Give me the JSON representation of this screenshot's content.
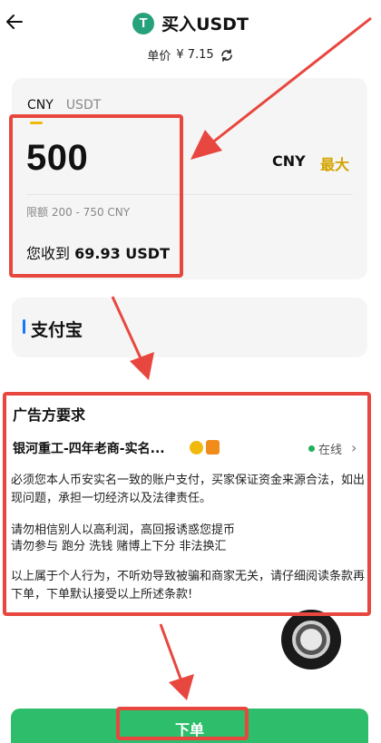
{
  "header": {
    "back_icon": "arrow-left-icon",
    "logo_icon": "tether-icon",
    "logo_letter": "T",
    "title": "买入USDT",
    "price_label": "单价",
    "price_value": "¥ 7.15",
    "refresh_icon": "refresh-icon"
  },
  "amount_card": {
    "tabs": [
      {
        "label": "CNY",
        "active": true
      },
      {
        "label": "USDT",
        "active": false
      }
    ],
    "amount": "500",
    "unit": "CNY",
    "max_label": "最大",
    "limit": "限额 200 - 750 CNY",
    "receive_label": "您收到",
    "receive_value": "69.93 USDT"
  },
  "payment": {
    "method": "支付宝"
  },
  "advertiser": {
    "section_title": "广告方要求",
    "merchant_name": "银河重工-四年老商-实名...",
    "status": "在线",
    "paragraphs": [
      "必须您本人币安实名一致的账户支付，买家保证资金来源合法，如出现问题，承担一切经济以及法律责任。",
      "请勿相信别人以高利润，高回报诱惑您提币",
      "请勿参与 跑分 洗钱 赌博上下分 非法换汇",
      "以上属于个人行为，不听劝导致被骗和商家无关，请仔细阅读条款再下单，下单默认接受以上所述条款!"
    ]
  },
  "order_button": "下单",
  "colors": {
    "accent_yellow": "#f0b90b",
    "max_text": "#d4a400",
    "green": "#2ebd6b",
    "tether_green": "#26a17b",
    "highlight_red": "#e8473f",
    "online_dot": "#1fb15a"
  }
}
